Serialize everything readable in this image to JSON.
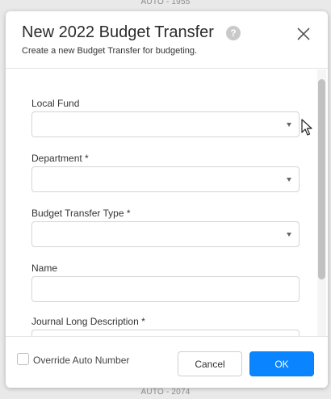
{
  "background": {
    "top_text": "AUTO - 1955",
    "bottom_text": "AUTO - 2074"
  },
  "modal": {
    "title": "New 2022 Budget Transfer",
    "help_icon_glyph": "?",
    "subtitle": "Create a new Budget Transfer for budgeting.",
    "close_icon": "close-icon"
  },
  "form": {
    "local_fund": {
      "label": "Local Fund",
      "value": ""
    },
    "department": {
      "label": "Department *",
      "value": ""
    },
    "budget_transfer_type": {
      "label": "Budget Transfer Type *",
      "value": ""
    },
    "name": {
      "label": "Name",
      "value": ""
    },
    "journal_long_description": {
      "label": "Journal Long Description *",
      "value": ""
    }
  },
  "footer": {
    "override_auto_number": {
      "label": "Override Auto Number",
      "checked": false
    },
    "cancel_label": "Cancel",
    "ok_label": "OK"
  },
  "colors": {
    "accent": "#0a84ff",
    "backdrop": "#e9e9e9",
    "border": "#d4d4d4"
  }
}
